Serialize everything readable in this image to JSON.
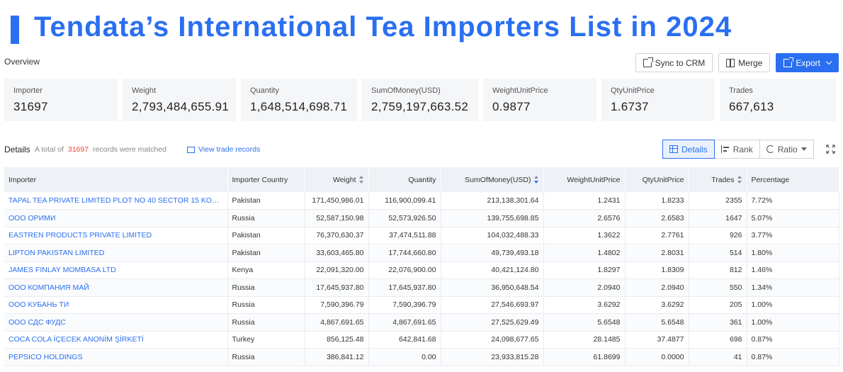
{
  "banner": {
    "title": "Tendata’s International Tea Importers List in 2024"
  },
  "overview": {
    "label": "Overview",
    "actions": {
      "sync": "Sync to CRM",
      "merge": "Merge",
      "export": "Export"
    },
    "stats": [
      {
        "label": "Importer",
        "value": "31697"
      },
      {
        "label": "Weight",
        "value": "2,793,484,655.91"
      },
      {
        "label": "Quantity",
        "value": "1,648,514,698.71"
      },
      {
        "label": "SumOfMoney(USD)",
        "value": "2,759,197,663.52"
      },
      {
        "label": "WeightUnitPrice",
        "value": "0.9877"
      },
      {
        "label": "QtyUnitPrice",
        "value": "1.6737"
      },
      {
        "label": "Trades",
        "value": "667,613"
      }
    ]
  },
  "details": {
    "title": "Details",
    "total_prefix": "A total of",
    "total_count": "31697",
    "total_suffix": "records were matched",
    "view_link": "View trade records",
    "tabs": {
      "details": "Details",
      "rank": "Rank",
      "ratio": "Ratio"
    }
  },
  "table": {
    "columns": {
      "importer": "Importer",
      "country": "Importer Country",
      "weight": "Weight",
      "quantity": "Quantity",
      "money": "SumOfMoney(USD)",
      "wup": "WeightUnitPrice",
      "qup": "QtyUnitPrice",
      "trades": "Trades",
      "percentage": "Percentage"
    },
    "rows": [
      {
        "importer": "TAPAL TEA PRIVATE LIMITED PLOT NO 40 SECTOR 15 KORANGI ...",
        "country": "Pakistan",
        "weight": "171,450,986.01",
        "quantity": "116,900,099.41",
        "money": "213,138,301.64",
        "wup": "1.2431",
        "qup": "1.8233",
        "trades": "2355",
        "percentage": "7.72%"
      },
      {
        "importer": "ООО ОРИМИ",
        "country": "Russia",
        "weight": "52,587,150.98",
        "quantity": "52,573,926.50",
        "money": "139,755,698.85",
        "wup": "2.6576",
        "qup": "2.6583",
        "trades": "1647",
        "percentage": "5.07%"
      },
      {
        "importer": "EASTREN PRODUCTS PRIVATE LIMITED",
        "country": "Pakistan",
        "weight": "76,370,630.37",
        "quantity": "37,474,511.88",
        "money": "104,032,488.33",
        "wup": "1.3622",
        "qup": "2.7761",
        "trades": "926",
        "percentage": "3.77%"
      },
      {
        "importer": "LIPTON PAKISTAN LIMITED",
        "country": "Pakistan",
        "weight": "33,603,465.80",
        "quantity": "17,744,660.80",
        "money": "49,739,493.18",
        "wup": "1.4802",
        "qup": "2.8031",
        "trades": "514",
        "percentage": "1.80%"
      },
      {
        "importer": "JAMES FINLAY MOMBASA LTD",
        "country": "Kenya",
        "weight": "22,091,320.00",
        "quantity": "22,076,900.00",
        "money": "40,421,124.80",
        "wup": "1.8297",
        "qup": "1.8309",
        "trades": "812",
        "percentage": "1.46%"
      },
      {
        "importer": "ООО КОМПАНИЯ МАЙ",
        "country": "Russia",
        "weight": "17,645,937.80",
        "quantity": "17,645,937.80",
        "money": "36,950,648.54",
        "wup": "2.0940",
        "qup": "2.0940",
        "trades": "550",
        "percentage": "1.34%"
      },
      {
        "importer": "ООО КУБАНЬ ТИ",
        "country": "Russia",
        "weight": "7,590,396.79",
        "quantity": "7,590,396.79",
        "money": "27,546,693.97",
        "wup": "3.6292",
        "qup": "3.6292",
        "trades": "205",
        "percentage": "1.00%"
      },
      {
        "importer": "ООО СДС ФУДС",
        "country": "Russia",
        "weight": "4,867,691.65",
        "quantity": "4,867,691.65",
        "money": "27,525,629.49",
        "wup": "5.6548",
        "qup": "5.6548",
        "trades": "361",
        "percentage": "1.00%"
      },
      {
        "importer": "COCA COLA İÇECEK ANONİM ŞİRKETİ",
        "country": "Turkey",
        "weight": "856,125.48",
        "quantity": "642,841.68",
        "money": "24,098,677.65",
        "wup": "28.1485",
        "qup": "37.4877",
        "trades": "698",
        "percentage": "0.87%"
      },
      {
        "importer": "PEPSICO HOLDINGS",
        "country": "Russia",
        "weight": "386,841.12",
        "quantity": "0.00",
        "money": "23,933,815.28",
        "wup": "61.8699",
        "qup": "0.0000",
        "trades": "41",
        "percentage": "0.87%"
      }
    ]
  }
}
